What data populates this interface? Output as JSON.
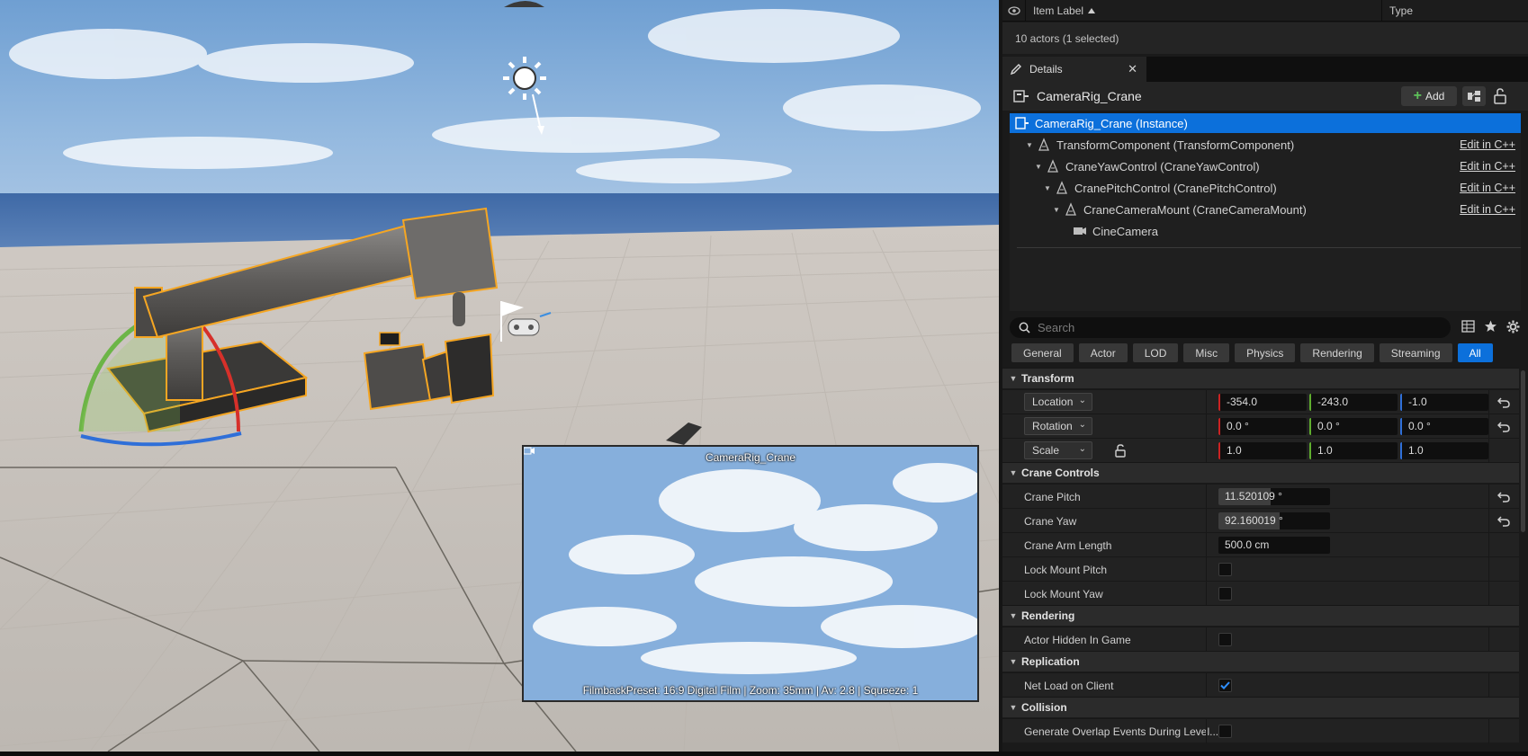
{
  "outliner": {
    "col_label": "Item Label",
    "col_type": "Type",
    "actors_count": "10 actors (1 selected)"
  },
  "details": {
    "tab_label": "Details",
    "actor_name": "CameraRig_Crane",
    "add_label": "Add",
    "tree": [
      {
        "label": "CameraRig_Crane (Instance)",
        "edit": ""
      },
      {
        "label": "TransformComponent (TransformComponent)",
        "edit": "Edit in C++"
      },
      {
        "label": "CraneYawControl (CraneYawControl)",
        "edit": "Edit in C++"
      },
      {
        "label": "CranePitchControl (CranePitchControl)",
        "edit": "Edit in C++"
      },
      {
        "label": "CraneCameraMount (CraneCameraMount)",
        "edit": "Edit in C++"
      },
      {
        "label": "CineCamera",
        "edit": ""
      }
    ],
    "search_placeholder": "Search",
    "filter_tabs": [
      "General",
      "Actor",
      "LOD",
      "Misc",
      "Physics",
      "Rendering",
      "Streaming",
      "All"
    ],
    "active_filter": "All",
    "transform": {
      "title": "Transform",
      "location_label": "Location",
      "rotation_label": "Rotation",
      "scale_label": "Scale",
      "location": [
        "-354.0",
        "-243.0",
        "-1.0"
      ],
      "rotation": [
        "0.0 °",
        "0.0 °",
        "0.0 °"
      ],
      "scale": [
        "1.0",
        "1.0",
        "1.0"
      ]
    },
    "crane_controls": {
      "title": "Crane Controls",
      "pitch_label": "Crane Pitch",
      "pitch_value": "11.520109 °",
      "pitch_fill": 0.47,
      "yaw_label": "Crane Yaw",
      "yaw_value": "92.160019 °",
      "yaw_fill": 0.55,
      "arm_label": "Crane Arm Length",
      "arm_value": "500.0 cm",
      "lock_pitch_label": "Lock Mount Pitch",
      "lock_pitch": false,
      "lock_yaw_label": "Lock Mount Yaw",
      "lock_yaw": false
    },
    "rendering": {
      "title": "Rendering",
      "hidden_label": "Actor Hidden In Game",
      "hidden": false
    },
    "replication": {
      "title": "Replication",
      "net_load_label": "Net Load on Client",
      "net_load": true
    },
    "collision": {
      "title": "Collision",
      "overlap_label": "Generate Overlap Events During Level..."
    }
  },
  "preview": {
    "title": "CameraRig_Crane",
    "info": "FilmbackPreset: 16:9 Digital Film | Zoom: 35mm | Av: 2.8 | Squeeze: 1"
  },
  "colors": {
    "accent": "#0c70db",
    "selection_outline": "#f5a623",
    "axis_x": "#cc2222",
    "axis_y": "#5fae2e",
    "axis_z": "#2f6fd8"
  }
}
